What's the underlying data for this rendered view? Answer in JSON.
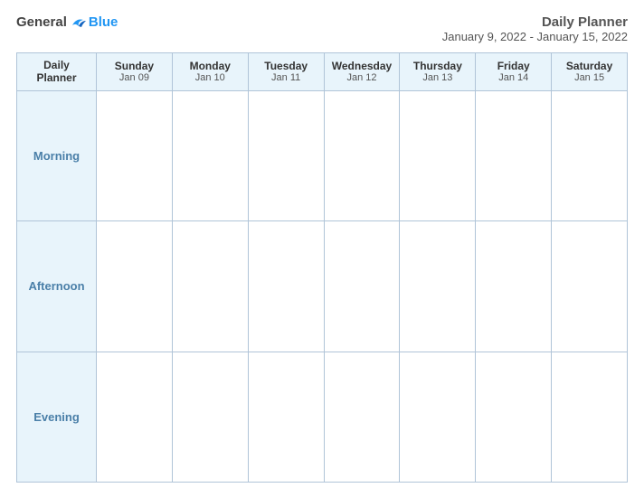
{
  "logo": {
    "general": "General",
    "blue": "Blue"
  },
  "title": {
    "main": "Daily Planner",
    "date_range": "January 9, 2022 - January 15, 2022"
  },
  "header_label": {
    "line1": "Daily",
    "line2": "Planner"
  },
  "days": [
    {
      "name": "Sunday",
      "date": "Jan 09"
    },
    {
      "name": "Monday",
      "date": "Jan 10"
    },
    {
      "name": "Tuesday",
      "date": "Jan 11"
    },
    {
      "name": "Wednesday",
      "date": "Jan 12"
    },
    {
      "name": "Thursday",
      "date": "Jan 13"
    },
    {
      "name": "Friday",
      "date": "Jan 14"
    },
    {
      "name": "Saturday",
      "date": "Jan 15"
    }
  ],
  "rows": [
    {
      "label": "Morning"
    },
    {
      "label": "Afternoon"
    },
    {
      "label": "Evening"
    }
  ]
}
